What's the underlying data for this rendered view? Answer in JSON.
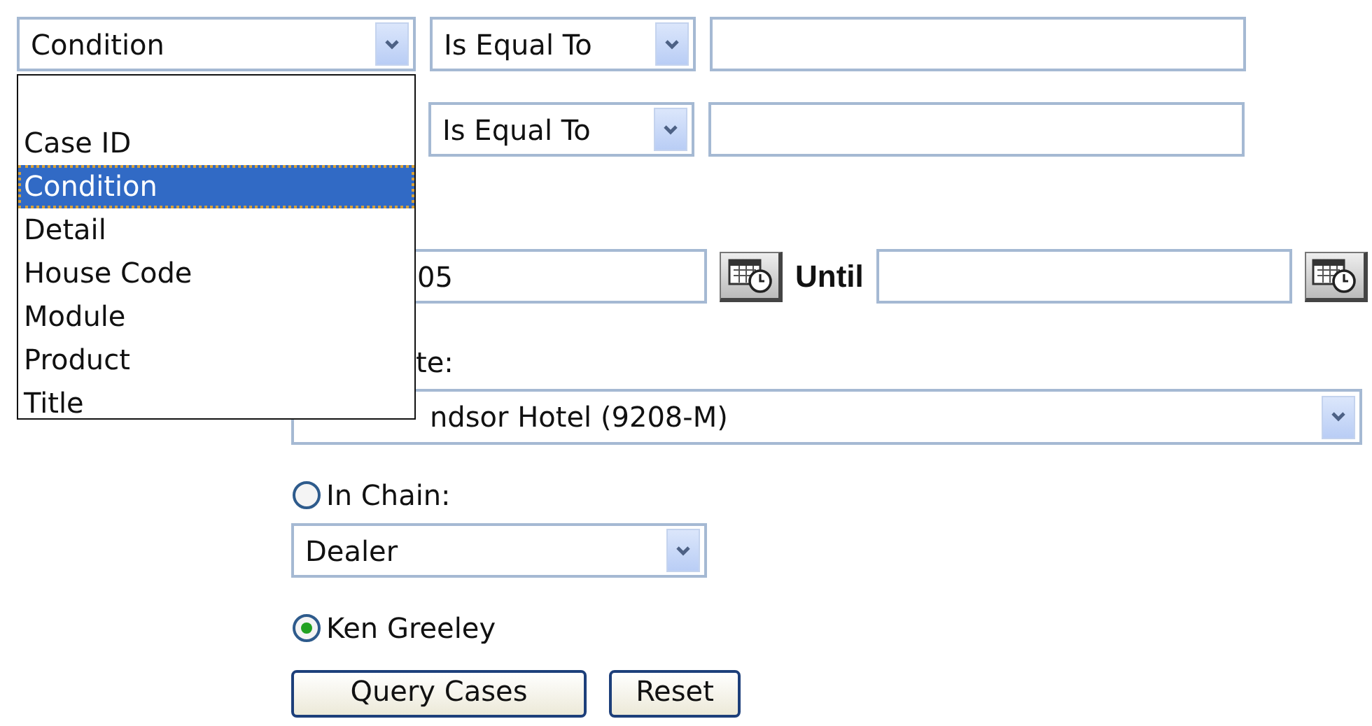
{
  "filters": [
    {
      "field": "Condition",
      "operator": "Is Equal To"
    },
    {
      "operator": "Is Equal To"
    }
  ],
  "field_list": {
    "expanded": true,
    "options": [
      {
        "label": "Case ID",
        "selected": false
      },
      {
        "label": "Condition",
        "selected": true
      },
      {
        "label": "Detail",
        "selected": false
      },
      {
        "label": "House Code",
        "selected": false
      },
      {
        "label": "Module",
        "selected": false
      },
      {
        "label": "Product",
        "selected": false
      },
      {
        "label": "Title",
        "selected": false
      }
    ]
  },
  "date_range": {
    "from_value": "05",
    "until_label": "Until"
  },
  "site": {
    "label": "te:",
    "value": "ndsor Hotel (9208-M)"
  },
  "scope": [
    {
      "kind": "chain",
      "label": "In Chain:",
      "selected": false,
      "select_value": "Dealer"
    },
    {
      "kind": "person",
      "label": "Ken Greeley",
      "selected": true
    }
  ],
  "buttons": [
    "Query Cases",
    "Reset"
  ]
}
